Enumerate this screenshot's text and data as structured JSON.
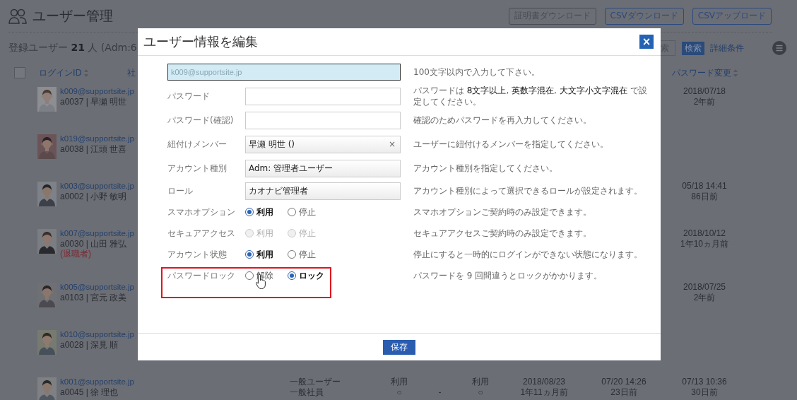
{
  "page": {
    "title": "ユーザー管理",
    "buttons": [
      {
        "label": "証明書ダウンロード",
        "disabled": true
      },
      {
        "label": "CSVダウンロード",
        "disabled": false
      },
      {
        "label": "CSVアップロード",
        "disabled": false
      }
    ],
    "summary": "登録ユーザー **21** 人 (Adm:6",
    "search": {
      "field_text": "索",
      "button": "検索",
      "link": "詳細条件"
    }
  },
  "table": {
    "select_all": {
      "checked": false
    },
    "columns": [
      "ログインID",
      "社",
      "パスワード変更"
    ],
    "rows": [
      {
        "login_id": "k009@supportsite.jp",
        "code_name": "a0037 | 早瀬 明世",
        "password_changed": [
          "2018/07/18",
          "2年前"
        ]
      },
      {
        "login_id": "k019@supportsite.jp",
        "code_name": "a0038 | 江頭 世喜"
      },
      {
        "login_id": "k003@supportsite.jp",
        "code_name": "a0002 | 小野 敏明",
        "password_changed": [
          "05/18 14:41",
          "86日前"
        ]
      },
      {
        "login_id": "k007@supportsite.jp",
        "code_name": "a0030 | 山田 雅弘",
        "note": "(退職者)",
        "password_changed": [
          "2018/10/12",
          "1年10ヵ月前"
        ]
      },
      {
        "login_id": "k005@supportsite.jp",
        "code_name": "a0103 | 宮元 政美",
        "password_changed": [
          "2018/07/25",
          "2年前"
        ]
      },
      {
        "login_id": "k010@supportsite.jp",
        "code_name": "a0028 | 深見 順"
      },
      {
        "login_id": "k001@supportsite.jp",
        "code_name": "a0045 | 徐 理也",
        "cells": [
          [
            "一般ユーザー",
            "一般社員"
          ],
          [
            "利用",
            "○"
          ],
          [
            "-"
          ],
          [
            "利用",
            "○"
          ],
          [
            "2018/08/23",
            "1年11ヵ月前"
          ],
          [
            "07/20 14:26",
            "23日前"
          ]
        ],
        "password_changed": [
          "07/13 10:36",
          "30日前"
        ]
      }
    ]
  },
  "modal": {
    "title": "ユーザー情報を編集",
    "close": "×",
    "save": "保存",
    "fields": [
      {
        "kind": "wide_input",
        "value": "k009@supportsite.jp",
        "hint": "100文字以内で入力して下さい。",
        "highlighted": false
      },
      {
        "kind": "input",
        "label": "パスワード",
        "hint": "パスワードは **8文字以上**, **英数字混在**, **大文字小文字混在** で設定してください。",
        "highlighted": false
      },
      {
        "kind": "input",
        "label": "パスワード(確認)",
        "hint": "確認のためパスワードを再入力してください。",
        "highlighted": false
      },
      {
        "kind": "tag_select",
        "label": "紐付けメンバー",
        "value": "早瀬 明世 ()",
        "clear": "×",
        "hint": "ユーザーに紐付けるメンバーを指定してください。",
        "highlighted": false
      },
      {
        "kind": "select",
        "label": "アカウント種別",
        "value": "Adm: 管理者ユーザー",
        "hint": "アカウント種別を指定してください。",
        "highlighted": false
      },
      {
        "kind": "select",
        "label": "ロール",
        "value": "カオナビ管理者",
        "hint": "アカウント種別によって選択できるロールが設定されます。",
        "highlighted": false
      },
      {
        "kind": "radio",
        "label": "スマホオプション",
        "disabled": false,
        "options": [
          {
            "label": "利用",
            "selected": true
          },
          {
            "label": "停止",
            "selected": false
          }
        ],
        "hint": "スマホオプションご契約時のみ設定できます。",
        "highlighted": false
      },
      {
        "kind": "radio",
        "label": "セキュアアクセス",
        "disabled": true,
        "options": [
          {
            "label": "利用",
            "selected": false
          },
          {
            "label": "停止",
            "selected": false
          }
        ],
        "hint": "セキュアアクセスご契約時のみ設定できます。",
        "highlighted": false
      },
      {
        "kind": "radio",
        "label": "アカウント状態",
        "disabled": false,
        "options": [
          {
            "label": "利用",
            "selected": true
          },
          {
            "label": "停止",
            "selected": false
          }
        ],
        "hint": "停止にすると一時的にログインができない状態になります。",
        "highlighted": false
      },
      {
        "kind": "radio",
        "label": "パスワードロック",
        "disabled": false,
        "options": [
          {
            "label": "解除",
            "selected": false
          },
          {
            "label": "ロック",
            "selected": true
          }
        ],
        "hint": "パスワードを 9 回間違うとロックがかかります。",
        "highlighted": true
      }
    ]
  }
}
